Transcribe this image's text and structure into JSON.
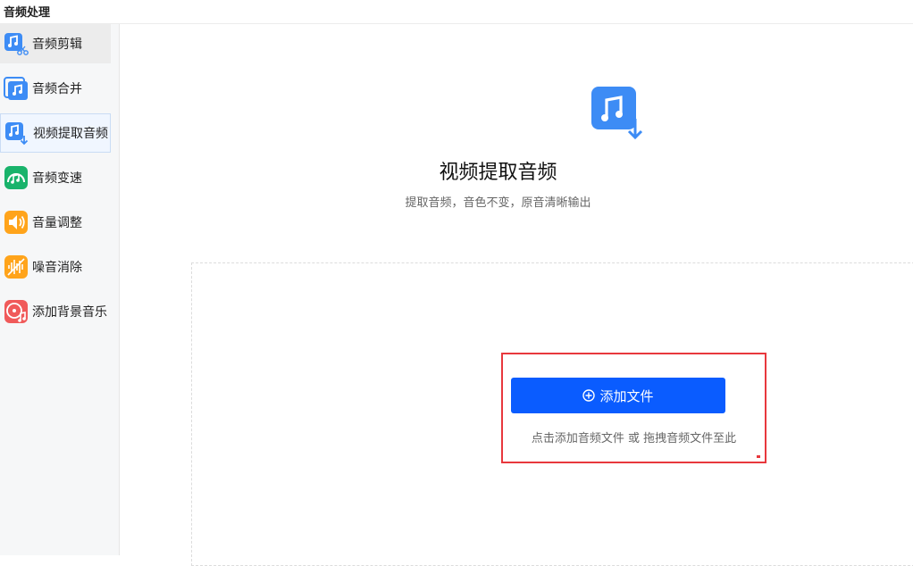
{
  "app": {
    "title": "音频处理"
  },
  "sidebar": {
    "items": [
      {
        "label": "音频剪辑",
        "icon": "audio-cut-icon",
        "color": "#3d8cf5"
      },
      {
        "label": "音频合并",
        "icon": "audio-merge-icon",
        "color": "#3d8cf5"
      },
      {
        "label": "视频提取音频",
        "icon": "audio-extract-icon",
        "color": "#3d8cf5"
      },
      {
        "label": "音频变速",
        "icon": "audio-speed-icon",
        "color": "#19b36b"
      },
      {
        "label": "音量调整",
        "icon": "volume-icon",
        "color": "#ffa41b"
      },
      {
        "label": "噪音消除",
        "icon": "noise-wave-icon",
        "color": "#ffa41b"
      },
      {
        "label": "添加背景音乐",
        "icon": "disc-music-icon",
        "color": "#f05a5a"
      }
    ]
  },
  "main": {
    "title": "视频提取音频",
    "subtitle": "提取音频，音色不变，原音清晰输出",
    "add_button": "添加文件",
    "hint": "点击添加音频文件 或 拖拽音频文件至此"
  },
  "colors": {
    "primary": "#0a5cff",
    "highlight": "#e8383d"
  }
}
